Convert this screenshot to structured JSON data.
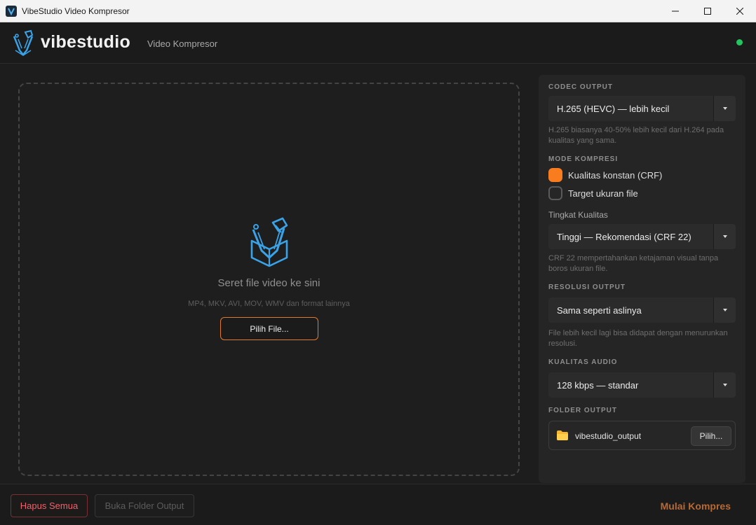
{
  "window": {
    "title": "VibeStudio Video Kompresor"
  },
  "header": {
    "brand": "vibestudio",
    "subtitle": "Video Kompresor",
    "status_color": "#22c55e"
  },
  "dropzone": {
    "title": "Seret file video ke sini",
    "formats": "MP4, MKV, AVI, MOV, WMV dan format lainnya",
    "button": "Pilih File..."
  },
  "settings": {
    "codec": {
      "label": "CODEC OUTPUT",
      "value": "H.265 (HEVC)  —  lebih kecil",
      "hint": "H.265 biasanya 40-50% lebih kecil dari H.264 pada kualitas yang sama."
    },
    "mode": {
      "label": "MODE KOMPRESI",
      "options": [
        {
          "label": "Kualitas konstan (CRF)",
          "selected": true
        },
        {
          "label": "Target ukuran file",
          "selected": false
        }
      ]
    },
    "quality": {
      "label": "Tingkat Kualitas",
      "value": "Tinggi — Rekomendasi (CRF 22)",
      "hint": "CRF 22 mempertahankan ketajaman visual tanpa boros ukuran file."
    },
    "resolution": {
      "label": "RESOLUSI OUTPUT",
      "value": "Sama seperti aslinya",
      "hint": "File lebih kecil lagi bisa didapat dengan menurunkan resolusi."
    },
    "audio": {
      "label": "KUALITAS AUDIO",
      "value": "128 kbps  —  standar"
    },
    "folder": {
      "label": "FOLDER OUTPUT",
      "name": "vibestudio_output",
      "button": "Pilih..."
    }
  },
  "footer": {
    "clear": "Hapus Semua",
    "open_folder": "Buka Folder Output",
    "start": "Mulai Kompres"
  },
  "colors": {
    "accent": "#f97c1f",
    "danger": "#f0616b",
    "icon_blue": "#3aa3e8"
  }
}
